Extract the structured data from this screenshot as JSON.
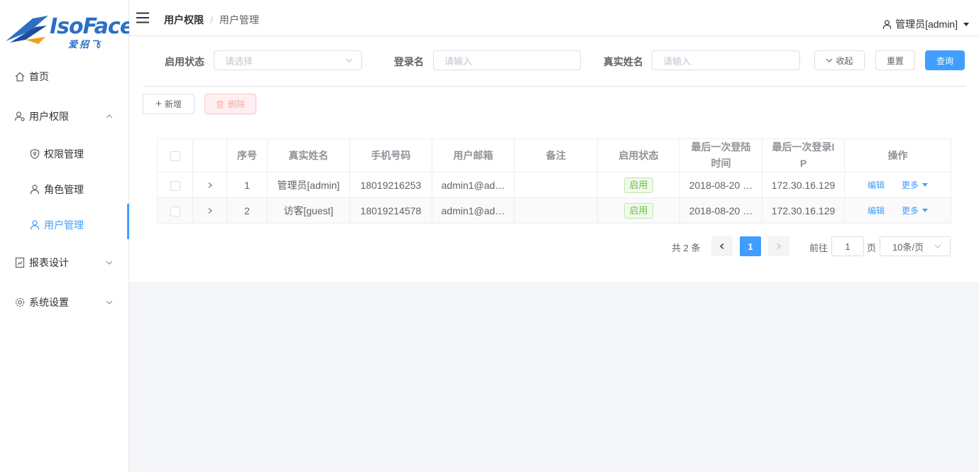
{
  "logo": {
    "word": "IsoFace",
    "sub": "爱招飞"
  },
  "sidebar": {
    "items": [
      {
        "label": "首页",
        "icon": "home-icon"
      },
      {
        "label": "用户权限",
        "icon": "user-key-icon",
        "expanded": true
      },
      {
        "label": "权限管理",
        "icon": "shield-icon"
      },
      {
        "label": "角色管理",
        "icon": "user-icon"
      },
      {
        "label": "用户管理",
        "icon": "user-icon",
        "active": true
      },
      {
        "label": "报表设计",
        "icon": "report-icon"
      },
      {
        "label": "系统设置",
        "icon": "gear-icon"
      }
    ]
  },
  "header": {
    "breadcrumb": [
      "用户权限",
      "用户管理"
    ],
    "breadcrumb_sep": "/",
    "user": "管理员[admin]"
  },
  "filters": {
    "status_label": "启用状态",
    "status_placeholder": "请选择",
    "login_label": "登录名",
    "login_placeholder": "请输入",
    "realname_label": "真实姓名",
    "realname_placeholder": "请输入",
    "collapse_label": "收起",
    "reset_label": "重置",
    "query_label": "查询"
  },
  "toolbar": {
    "add_label": "新增",
    "delete_label": "删除"
  },
  "table": {
    "columns": [
      "序号",
      "真实姓名",
      "手机号码",
      "用户邮箱",
      "备注",
      "启用状态",
      "最后一次登陆时间",
      "最后一次登录IP",
      "操作"
    ],
    "rows": [
      {
        "index": "1",
        "name": "管理员[admin]",
        "phone": "18019216253",
        "email": "admin1@ad…",
        "remark": "",
        "status": "启用",
        "last_login": "2018-08-20 …",
        "ip": "172.30.16.129"
      },
      {
        "index": "2",
        "name": "访客[guest]",
        "phone": "18019214578",
        "email": "admin1@ad…",
        "remark": "",
        "status": "启用",
        "last_login": "2018-08-20 …",
        "ip": "172.30.16.129"
      }
    ],
    "edit_label": "编辑",
    "more_label": "更多"
  },
  "pagination": {
    "total": "共 2 条",
    "current": "1",
    "goto_label": "前往",
    "goto_value": "1",
    "page_unit": "页",
    "page_size": "10条/页"
  },
  "colors": {
    "primary": "#409eff",
    "success": "#67c23a",
    "danger_light": "#fef0f0"
  }
}
